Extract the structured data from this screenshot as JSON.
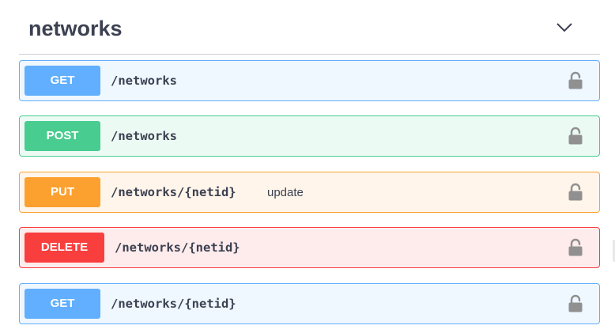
{
  "tag": {
    "title": "networks",
    "toggle_icon": "chevron-down-icon"
  },
  "operations": [
    {
      "method": "GET",
      "path": "/networks",
      "summary": "",
      "lock_icon": "unlocked-lock-icon"
    },
    {
      "method": "POST",
      "path": "/networks",
      "summary": "",
      "lock_icon": "unlocked-lock-icon"
    },
    {
      "method": "PUT",
      "path": "/networks/{netid}",
      "summary": "update",
      "lock_icon": "unlocked-lock-icon"
    },
    {
      "method": "DELETE",
      "path": "/networks/{netid}",
      "summary": "",
      "lock_icon": "unlocked-lock-icon"
    },
    {
      "method": "GET",
      "path": "/networks/{netid}",
      "summary": "",
      "lock_icon": "unlocked-lock-icon"
    }
  ],
  "colors": {
    "get": "#61affe",
    "post": "#49cc90",
    "put": "#fca130",
    "delete": "#f93e3e",
    "text": "#3b4151",
    "lock": "#909090"
  }
}
